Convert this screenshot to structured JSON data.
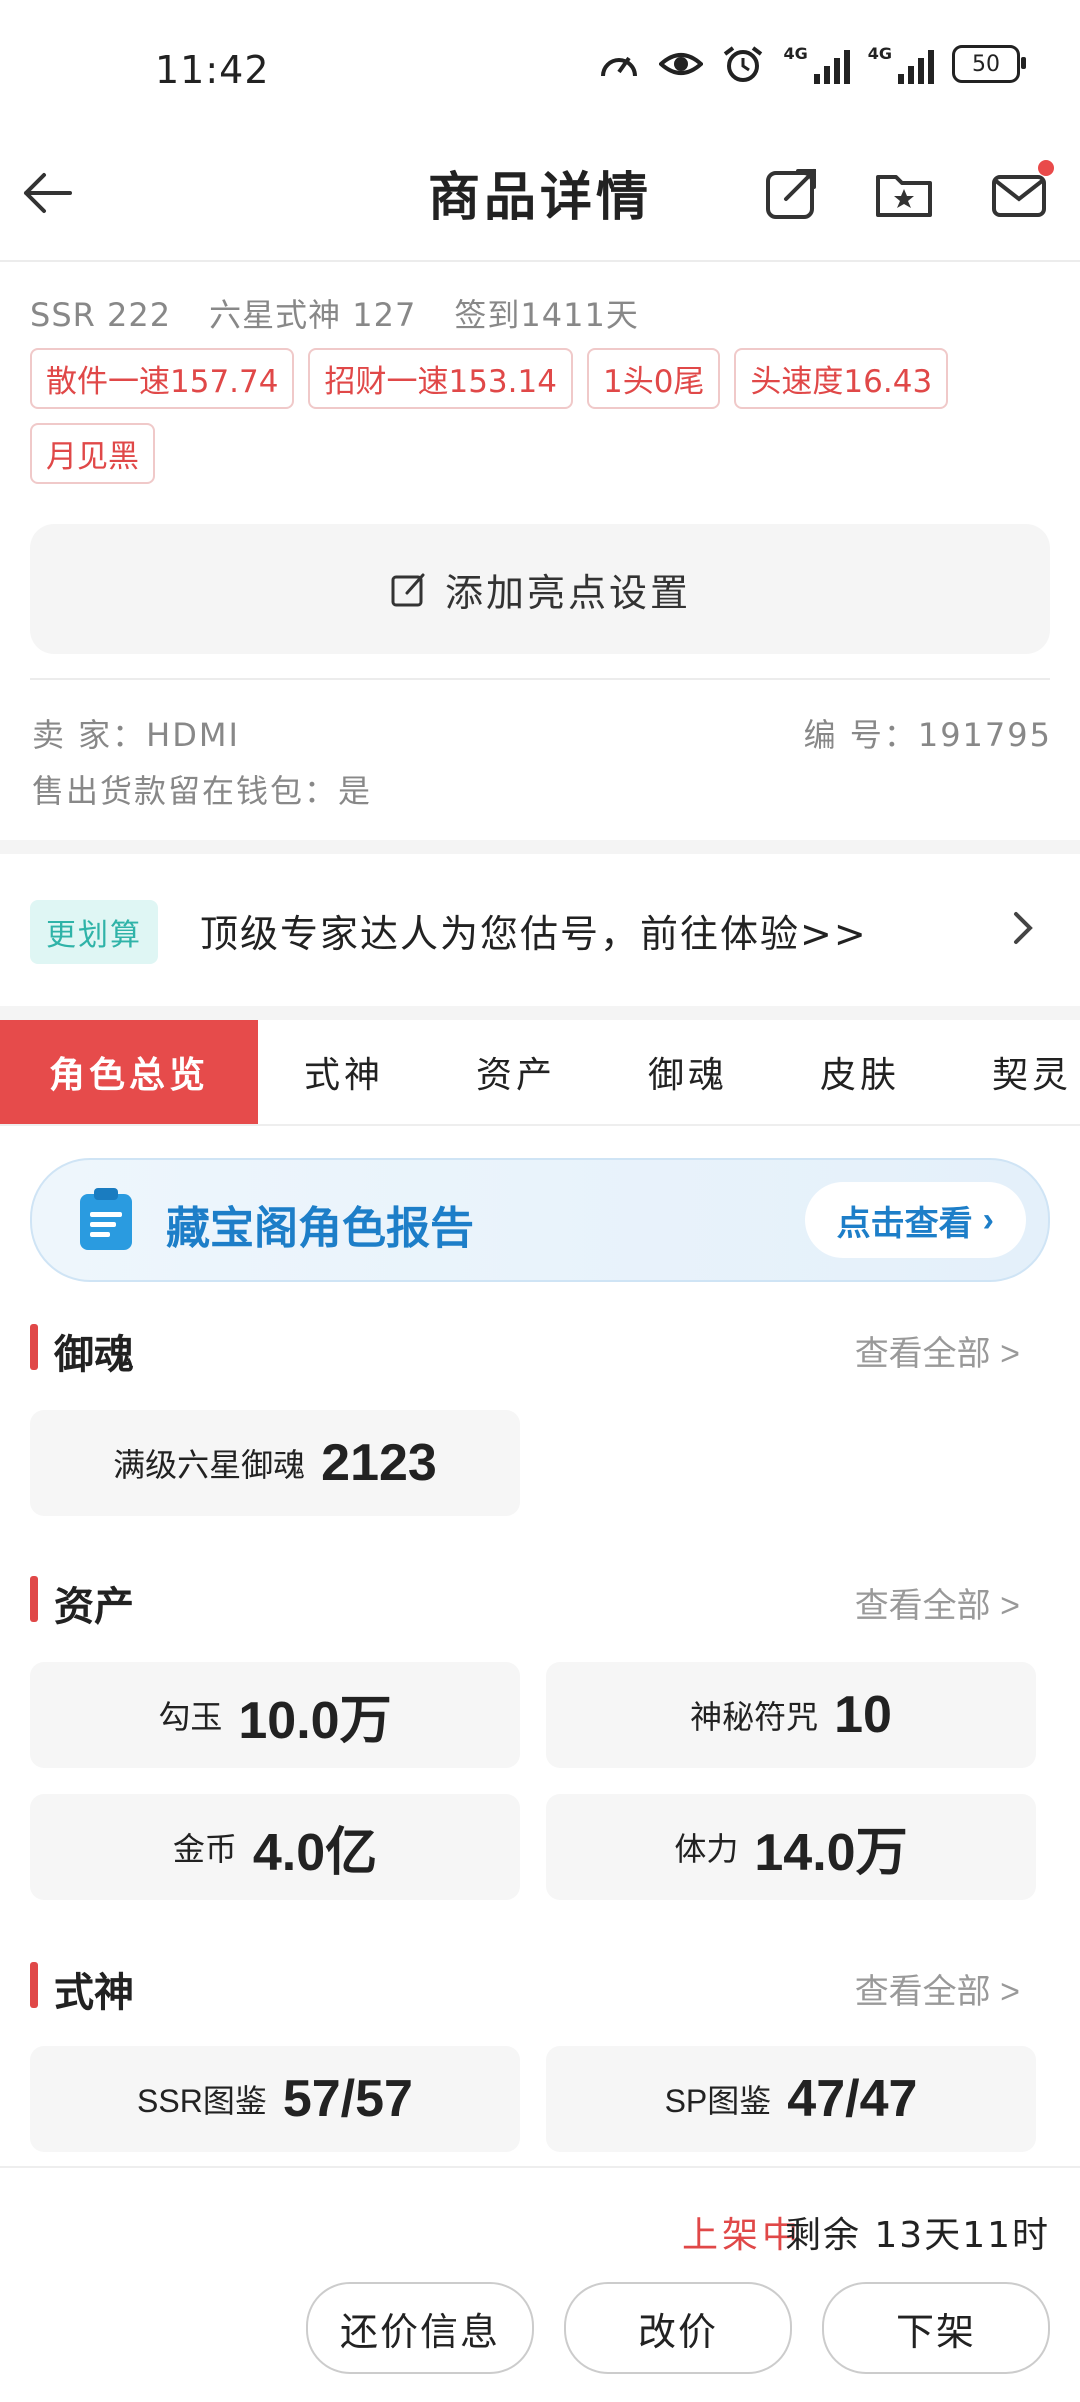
{
  "status_bar": {
    "time": "11:42",
    "network_1": "4G",
    "network_2": "4G",
    "battery": "50"
  },
  "header": {
    "title": "商品详情",
    "icons": [
      "back-arrow-icon",
      "share-icon",
      "favorite-folder-icon",
      "message-icon"
    ],
    "has_notification": true
  },
  "summary": {
    "stats": [
      "SSR 222",
      "六星式神 127",
      "签到1411天"
    ],
    "tags": [
      "散件一速157.74",
      "招财一速153.14",
      "1头0尾",
      "头速度16.43",
      "月见黑"
    ],
    "highlight_button": "添加亮点设置",
    "seller_label": "卖 家：HDMI",
    "id_label": "编 号：191795",
    "payout_label": "售出货款留在钱包：是"
  },
  "promo": {
    "badge": "更划算",
    "text": "顶级专家达人为您估号，前往体验>>"
  },
  "tabs": [
    "角色总览",
    "式神",
    "资产",
    "御魂",
    "皮肤",
    "契灵"
  ],
  "active_tab": 0,
  "report": {
    "title": "藏宝阁角色报告",
    "button": "点击查看"
  },
  "sections": {
    "yuhun": {
      "title": "御魂",
      "more": "查看全部 >",
      "cards": [
        {
          "label": "满级六星御魂",
          "value": "2123"
        }
      ]
    },
    "assets": {
      "title": "资产",
      "more": "查看全部 >",
      "cards": [
        {
          "label": "勾玉",
          "value": "10.0万"
        },
        {
          "label": "神秘符咒",
          "value": "10"
        },
        {
          "label": "金币",
          "value": "4.0亿"
        },
        {
          "label": "体力",
          "value": "14.0万"
        }
      ]
    },
    "shishen": {
      "title": "式神",
      "more": "查看全部 >",
      "cards": [
        {
          "label": "SSR图鉴",
          "value": "57/57"
        },
        {
          "label": "SP图鉴",
          "value": "47/47"
        }
      ]
    }
  },
  "bottom": {
    "status": "上架中",
    "remaining": "剩余 13天11时",
    "buttons": [
      "还价信息",
      "改价",
      "下架"
    ]
  },
  "colors": {
    "accent_red": "#e64b4b",
    "report_blue": "#1d7ec8",
    "promo_teal": "#2fb3a8"
  }
}
